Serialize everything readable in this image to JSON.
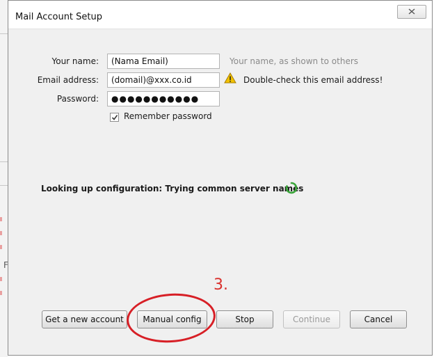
{
  "window": {
    "title": "Mail Account Setup"
  },
  "form": {
    "name_label": "Your name:",
    "name_value": "(Nama Email)",
    "name_hint": "Your name, as shown to others",
    "email_label": "Email address:",
    "email_value": "(domail)@xxx.co.id",
    "email_warning": "Double-check this email address!",
    "password_label": "Password:",
    "password_value": "●●●●●●●●●●●",
    "remember_label": "Remember password",
    "remember_checked": true
  },
  "status": {
    "text": "Looking up configuration: Trying common server names"
  },
  "annotation": {
    "step": "3."
  },
  "buttons": {
    "get_account": "Get a new account",
    "manual_config": "Manual config",
    "stop": "Stop",
    "continue": "Continue",
    "cancel": "Cancel"
  },
  "colors": {
    "annotation_red": "#d71f26",
    "spinner_green": "#3aa53a",
    "warning_yellow": "#f2c200"
  }
}
